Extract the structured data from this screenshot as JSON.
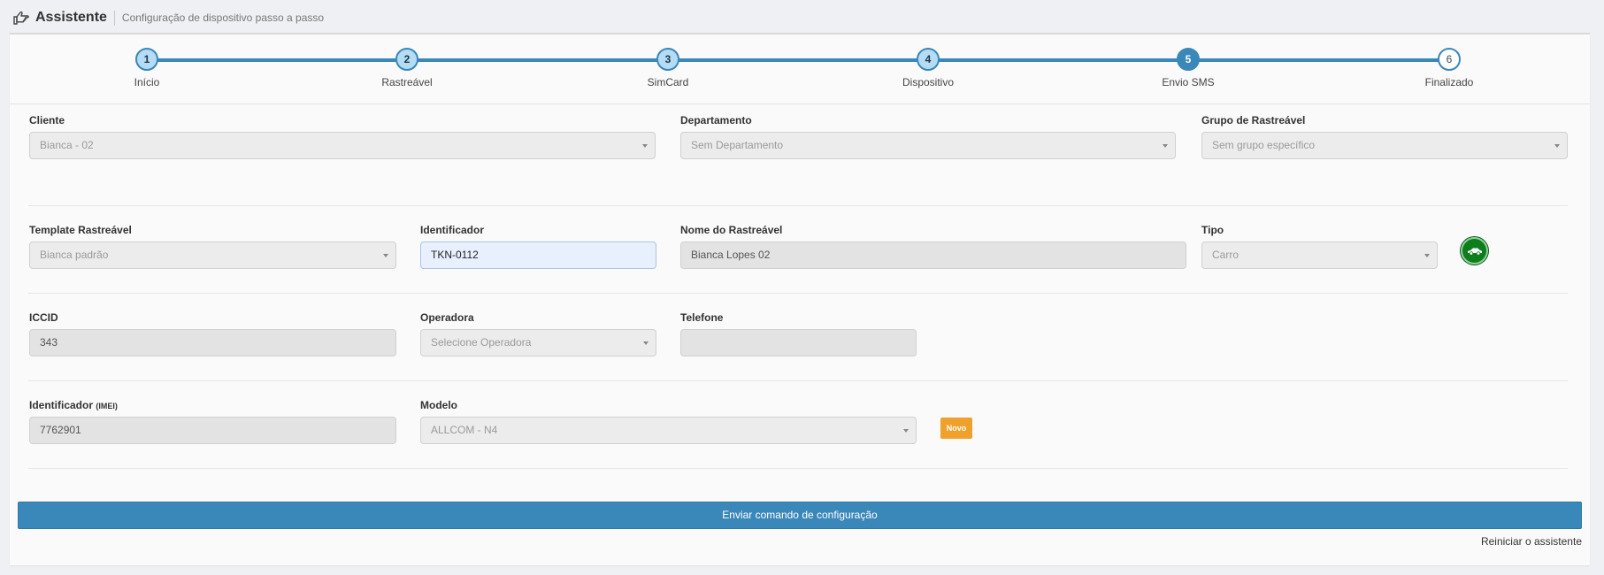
{
  "header": {
    "title": "Assistente",
    "subtitle": "Configuração de dispositivo passo a passo"
  },
  "wizard": {
    "steps": [
      {
        "number": "1",
        "label": "Início",
        "state": "done"
      },
      {
        "number": "2",
        "label": "Rastreável",
        "state": "done"
      },
      {
        "number": "3",
        "label": "SimCard",
        "state": "done"
      },
      {
        "number": "4",
        "label": "Dispositivo",
        "state": "done"
      },
      {
        "number": "5",
        "label": "Envio SMS",
        "state": "active"
      },
      {
        "number": "6",
        "label": "Finalizado",
        "state": "pending"
      }
    ]
  },
  "form": {
    "cliente": {
      "label": "Cliente",
      "value": "Bianca - 02"
    },
    "departamento": {
      "label": "Departamento",
      "value": "Sem Departamento"
    },
    "grupo": {
      "label": "Grupo de Rastreável",
      "value": "Sem grupo específico"
    },
    "template": {
      "label": "Template Rastreável",
      "value": "Bianca padrão"
    },
    "identificador": {
      "label": "Identificador",
      "value": "TKN-0112"
    },
    "nome": {
      "label": "Nome do Rastreável",
      "value": "Bianca Lopes 02"
    },
    "tipo": {
      "label": "Tipo",
      "value": "Carro"
    },
    "iccid": {
      "label": "ICCID",
      "value": "343"
    },
    "operadora": {
      "label": "Operadora",
      "value": "Selecione Operadora"
    },
    "telefone": {
      "label": "Telefone",
      "value": ""
    },
    "imei": {
      "label": "Identificador",
      "label_suffix": "(IMEI)",
      "value": "7762901"
    },
    "modelo": {
      "label": "Modelo",
      "value": "ALLCOM - N4"
    },
    "novo_badge": "Novo"
  },
  "actions": {
    "send_label": "Enviar comando de configuração",
    "restart_label": "Reiniciar o assistente"
  },
  "colors": {
    "primary": "#3a87b9",
    "step_done": "#b4dcf4",
    "car_button": "#0e7e1d",
    "badge_new": "#f0a12c"
  },
  "icons": {
    "header": "thumbs-up-pointing-icon",
    "tipo": "car-icon",
    "select": "chevron-down-icon"
  }
}
